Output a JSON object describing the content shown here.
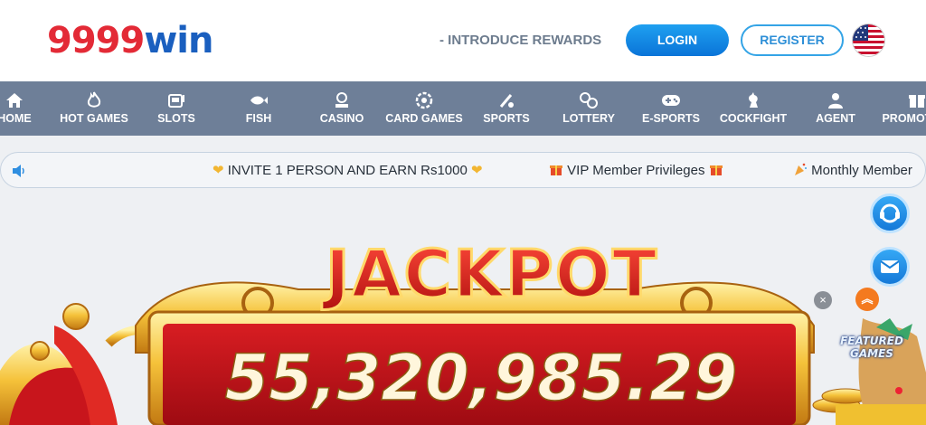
{
  "header": {
    "logo_part1": "9999",
    "logo_part2": "win",
    "introduce_rewards": "- INTRODUCE REWARDS",
    "login_label": "LOGIN",
    "register_label": "REGISTER",
    "language_icon": "us-flag-icon"
  },
  "nav": {
    "items": [
      {
        "label": "HOME",
        "icon": "home-icon"
      },
      {
        "label": "HOT GAMES",
        "icon": "fire-icon"
      },
      {
        "label": "SLOTS",
        "icon": "slot-machine-icon"
      },
      {
        "label": "FISH",
        "icon": "fish-icon"
      },
      {
        "label": "CASINO",
        "icon": "dealer-icon"
      },
      {
        "label": "CARD GAMES",
        "icon": "poker-chip-icon"
      },
      {
        "label": "SPORTS",
        "icon": "sports-icon"
      },
      {
        "label": "LOTTERY",
        "icon": "lottery-balls-icon"
      },
      {
        "label": "E-SPORTS",
        "icon": "gamepad-icon"
      },
      {
        "label": "COCKFIGHT",
        "icon": "rooster-icon"
      },
      {
        "label": "AGENT",
        "icon": "agent-icon"
      },
      {
        "label": "PROMOTION",
        "icon": "gift-icon"
      }
    ]
  },
  "marquee": {
    "item1": "INVITE 1 PERSON AND EARN Rs1000",
    "item2": "VIP Member Privileges",
    "item3": "Monthly Member"
  },
  "banner": {
    "title": "JACKPOT",
    "amount": "55,320,985.29"
  },
  "floating": {
    "featured_label_1": "FEATURED",
    "featured_label_2": "GAMES",
    "close_symbol": "×",
    "up_symbol": "︽"
  },
  "colors": {
    "brand_red": "#e32a36",
    "brand_blue": "#1a5fbf",
    "nav_bg": "#6e7f98",
    "login_blue": "#0a74d8",
    "jackpot_red": "#c4121a",
    "gold": "#f5c23a"
  }
}
